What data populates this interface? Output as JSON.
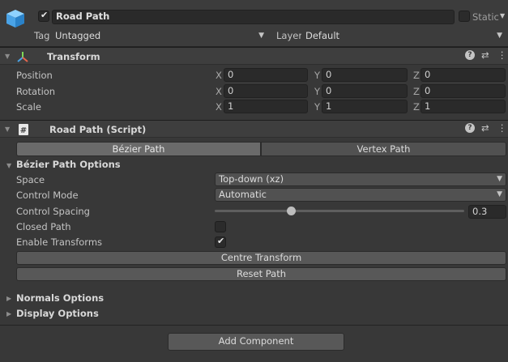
{
  "object": {
    "enabled": true,
    "name": "Road Path",
    "static_label": "Static",
    "tag_label": "Tag",
    "tag_value": "Untagged",
    "layer_label": "Layer",
    "layer_value": "Default"
  },
  "transform": {
    "title": "Transform",
    "rows": [
      {
        "label": "Position",
        "x": "0",
        "y": "0",
        "z": "0"
      },
      {
        "label": "Rotation",
        "x": "0",
        "y": "0",
        "z": "0"
      },
      {
        "label": "Scale",
        "x": "1",
        "y": "1",
        "z": "1"
      }
    ],
    "axis_x": "X",
    "axis_y": "Y",
    "axis_z": "Z"
  },
  "script": {
    "title": "Road Path (Script)",
    "tabs": [
      "Bézier Path",
      "Vertex Path"
    ],
    "active_tab": 0,
    "section_title": "Bézier Path Options",
    "space_label": "Space",
    "space_value": "Top-down (xz)",
    "control_mode_label": "Control Mode",
    "control_mode_value": "Automatic",
    "control_spacing_label": "Control Spacing",
    "control_spacing_value": "0.3",
    "closed_path_label": "Closed Path",
    "closed_path_checked": false,
    "enable_transforms_label": "Enable Transforms",
    "enable_transforms_checked": true,
    "centre_transform_label": "Centre Transform",
    "reset_path_label": "Reset Path",
    "normals_options_label": "Normals Options",
    "display_options_label": "Display Options"
  },
  "footer": {
    "add_component_label": "Add Component"
  },
  "icons": {
    "help": "?",
    "presets": "⇄",
    "menu": "⋮"
  }
}
